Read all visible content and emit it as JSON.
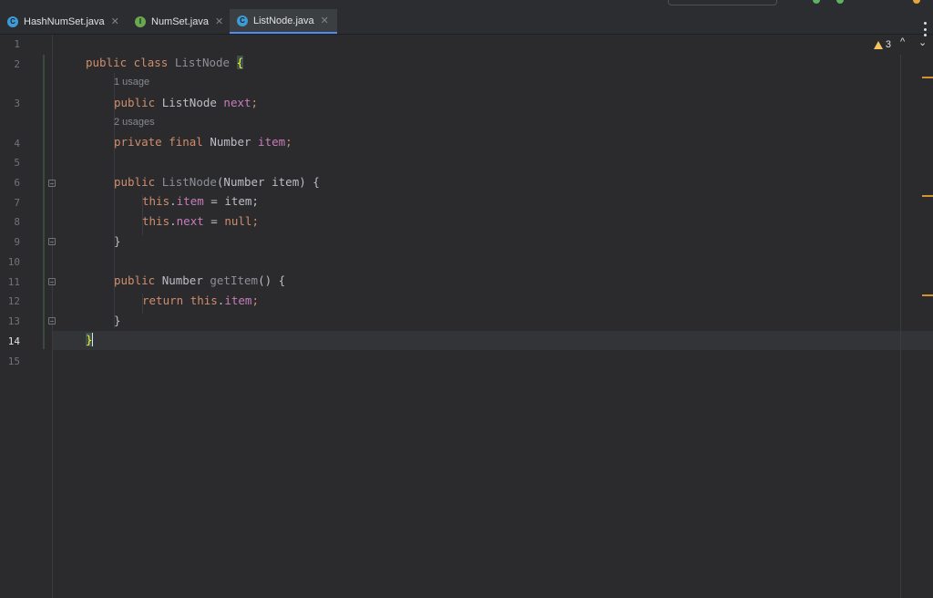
{
  "tabs": [
    {
      "label": "HashNumSet.java",
      "icon": "class-icon",
      "icon_letter": "C",
      "icon_color": "#3d9bd6",
      "active": false
    },
    {
      "label": "NumSet.java",
      "icon": "interface-icon",
      "icon_letter": "I",
      "icon_color": "#6aa84f",
      "active": false
    },
    {
      "label": "ListNode.java",
      "icon": "class-icon",
      "icon_letter": "C",
      "icon_color": "#3d9bd6",
      "active": true
    }
  ],
  "gutter": {
    "line_numbers": [
      "1",
      "2",
      "3",
      "4",
      "5",
      "6",
      "7",
      "8",
      "9",
      "10",
      "11",
      "12",
      "13",
      "14",
      "15"
    ],
    "current_line": "14"
  },
  "inspections": {
    "warning_count": "3",
    "prev_label": "^",
    "next_label": "⌄"
  },
  "hints": {
    "next_usages": "1 usage",
    "item_usages": "2 usages"
  },
  "code": {
    "l2": {
      "kw": "public class ",
      "name": "ListNode",
      "brace": "{"
    },
    "l3": {
      "kw": "public ",
      "type": "ListNode ",
      "field": "next",
      "semi": ";"
    },
    "l4": {
      "kw": "private final ",
      "type": "Number ",
      "field": "item",
      "semi": ";"
    },
    "l6": {
      "kw": "public ",
      "name": "ListNode",
      "rest": "(Number item) {"
    },
    "l7": {
      "kw": "this",
      "dot": ".",
      "field": "item",
      "rest": " = item;"
    },
    "l8": {
      "kw": "this",
      "dot": ".",
      "field": "next",
      "rest": " = ",
      "kw2": "null",
      "semi": ";"
    },
    "l9": {
      "rest": "}"
    },
    "l11": {
      "kw": "public ",
      "type": "Number ",
      "name": "getItem",
      "rest": "() {"
    },
    "l12": {
      "kw": "return ",
      "kw2": "this",
      "dot": ".",
      "field": "item",
      "semi": ";"
    },
    "l13": {
      "rest": "}"
    },
    "l14": {
      "brace": "}"
    }
  },
  "colors": {
    "keyword": "#cf8e6d",
    "field": "#c77dbb",
    "warning": "#f2c55c",
    "active_tab_underline": "#4d8ff0",
    "marker_stripe": "#d3932e"
  }
}
